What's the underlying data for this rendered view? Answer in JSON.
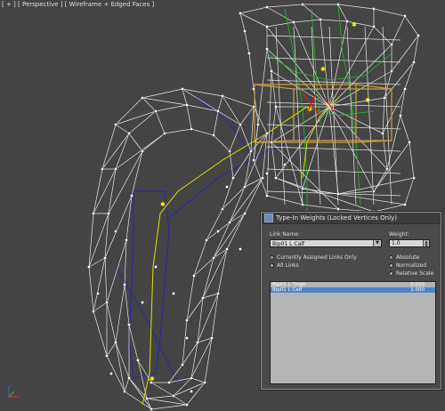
{
  "viewport": {
    "label_plus": "[ + ]",
    "label_view": "[ Perspective ]",
    "label_mode": "[ Wireframe + Edged Faces ]"
  },
  "dialog": {
    "title": "Type-In Weights (Locked Vertices Only)",
    "link_name_label": "Link Name:",
    "link_name_value": "Bip01 L Calf",
    "weight_label": "Weight:",
    "weight_value": "1.0",
    "radio_current": "Currently Assigned Links Only",
    "radio_all": "All Links",
    "radio_absolute": "Absolute",
    "radio_normalized": "Normalized",
    "radio_relative": "Relative Scale",
    "links": [
      {
        "name": "Bip01 L Thigh",
        "weight": "0.000",
        "selected": false
      },
      {
        "name": "Bip01 L Calf",
        "weight": "1.000",
        "selected": true
      }
    ]
  },
  "colors": {
    "viewport_bg": "#444444",
    "wire_white": "#ffffff",
    "wire_blue": "#2626a8",
    "wire_yellow": "#e8e800",
    "wire_green": "#20c020",
    "bbox_orange": "#c8a040",
    "selection_blue": "#4d86c9"
  }
}
